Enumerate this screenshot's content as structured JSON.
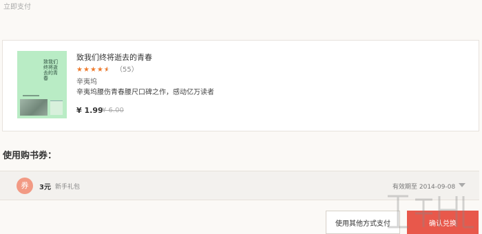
{
  "page": {
    "title": "立即支付"
  },
  "book": {
    "cover_title": "致我们终将逝去的青春",
    "title": "致我们终将逝去的青春",
    "rating": 4.5,
    "review_count_text": "（55）",
    "author": "辛夷坞",
    "description": "辛夷坞腰伤青春腰尺口碑之作，感动亿万读者",
    "price": "¥ 1.99",
    "original_price": "¥ 6.00"
  },
  "coupons": {
    "heading": "使用购书券：",
    "items": [
      {
        "badge": "券",
        "amount": "3元",
        "name": "新手礼包",
        "expiry": "有效期至 2014-09-08"
      }
    ]
  },
  "actions": {
    "other_payment_label": "使用其他方式支付",
    "confirm_label": "确认兑换"
  },
  "colors": {
    "accent": "#e8584b",
    "star": "#ee7a2c",
    "coupon_badge": "#f29a84",
    "cover": "#b9ecc5"
  }
}
